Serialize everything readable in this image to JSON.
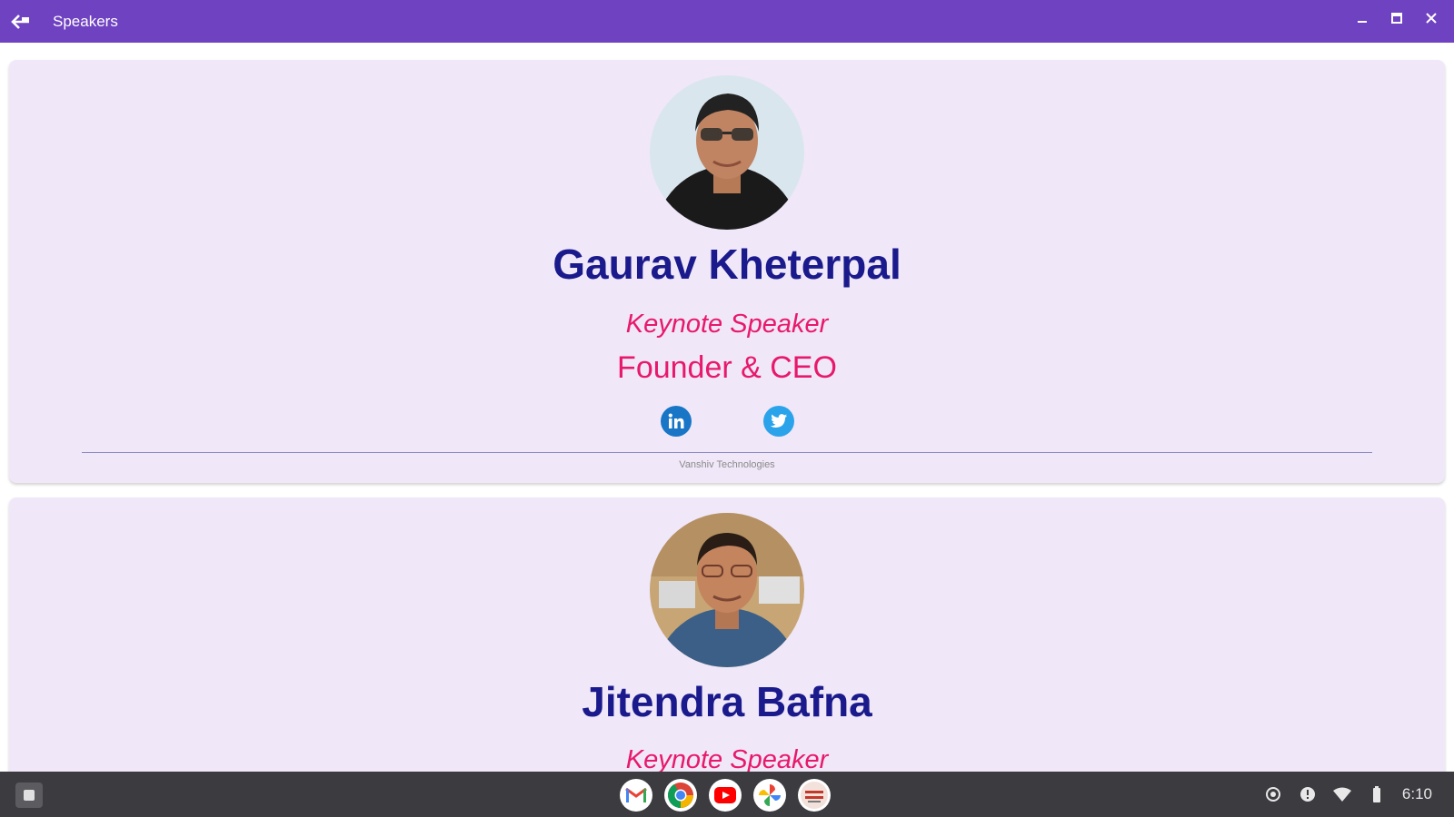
{
  "window": {
    "title": "Speakers",
    "back_icon": "back-arrow-icon",
    "controls": [
      "minimize-icon",
      "maximize-icon",
      "close-icon"
    ]
  },
  "speakers": [
    {
      "name": "Gaurav Kheterpal",
      "role": "Keynote Speaker",
      "job_title": "Founder & CEO",
      "company": "Vanshiv Technologies",
      "socials": [
        "linkedin-icon",
        "twitter-icon"
      ]
    },
    {
      "name": "Jitendra Bafna",
      "role": "Keynote Speaker"
    }
  ],
  "shelf": {
    "apps": [
      "gmail-icon",
      "chrome-icon",
      "youtube-icon",
      "photos-icon",
      "speakers-app-icon"
    ],
    "clock": "6:10"
  },
  "colors": {
    "titlebar": "#6f42c1",
    "card_background": "#f0e7f8",
    "name": "#1a1a8c",
    "accent": "#e8196b"
  }
}
